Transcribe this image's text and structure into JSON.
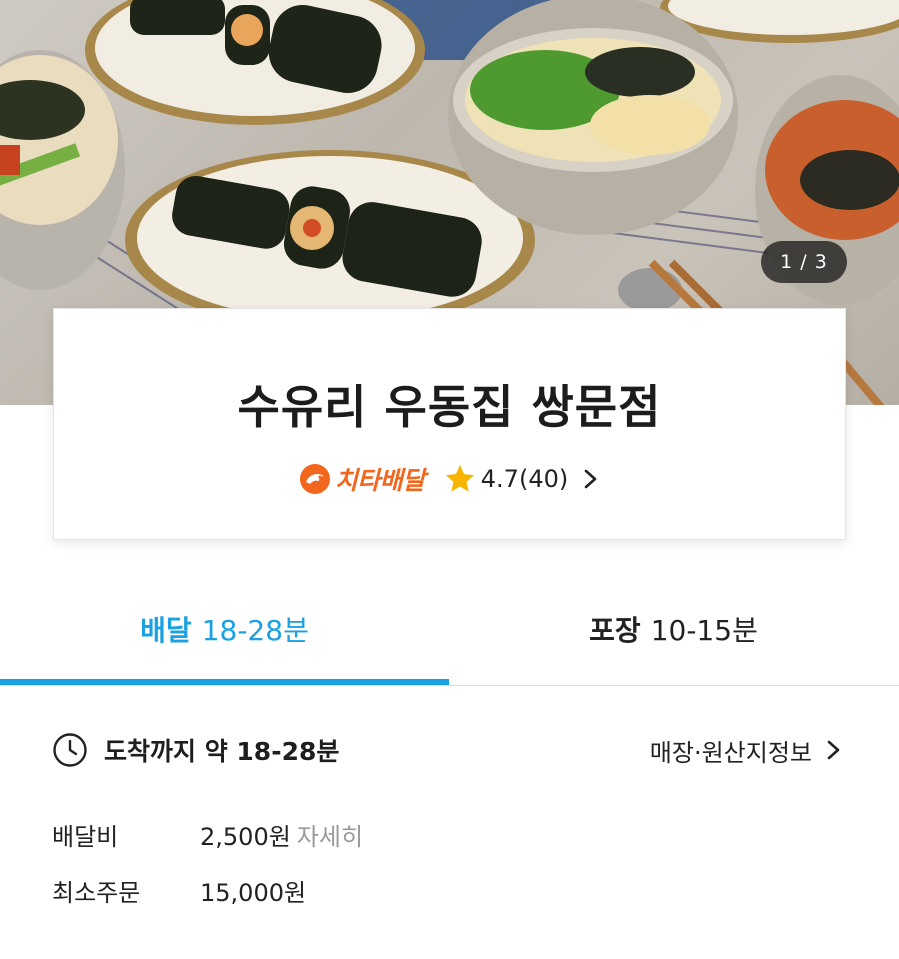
{
  "hero": {
    "page_counter": "1 / 3"
  },
  "store": {
    "name": "수유리 우동집 쌍문점",
    "delivery_brand": "치타배달",
    "rating": "4.7(40)",
    "brand_color": "#f2661d",
    "star_color": "#f7b500"
  },
  "tabs": {
    "delivery": {
      "label": "배달",
      "time": "18-28분",
      "active": true
    },
    "pickup": {
      "label": "포장",
      "time": "10-15분",
      "active": false
    },
    "accent": "#1ba1e1"
  },
  "arrival": {
    "text": "도착까지 약 18-28분",
    "info_link": "매장·원산지정보"
  },
  "fees": [
    {
      "label": "배달비",
      "value": "2,500원",
      "link": "자세히"
    },
    {
      "label": "최소주문",
      "value": "15,000원"
    }
  ]
}
